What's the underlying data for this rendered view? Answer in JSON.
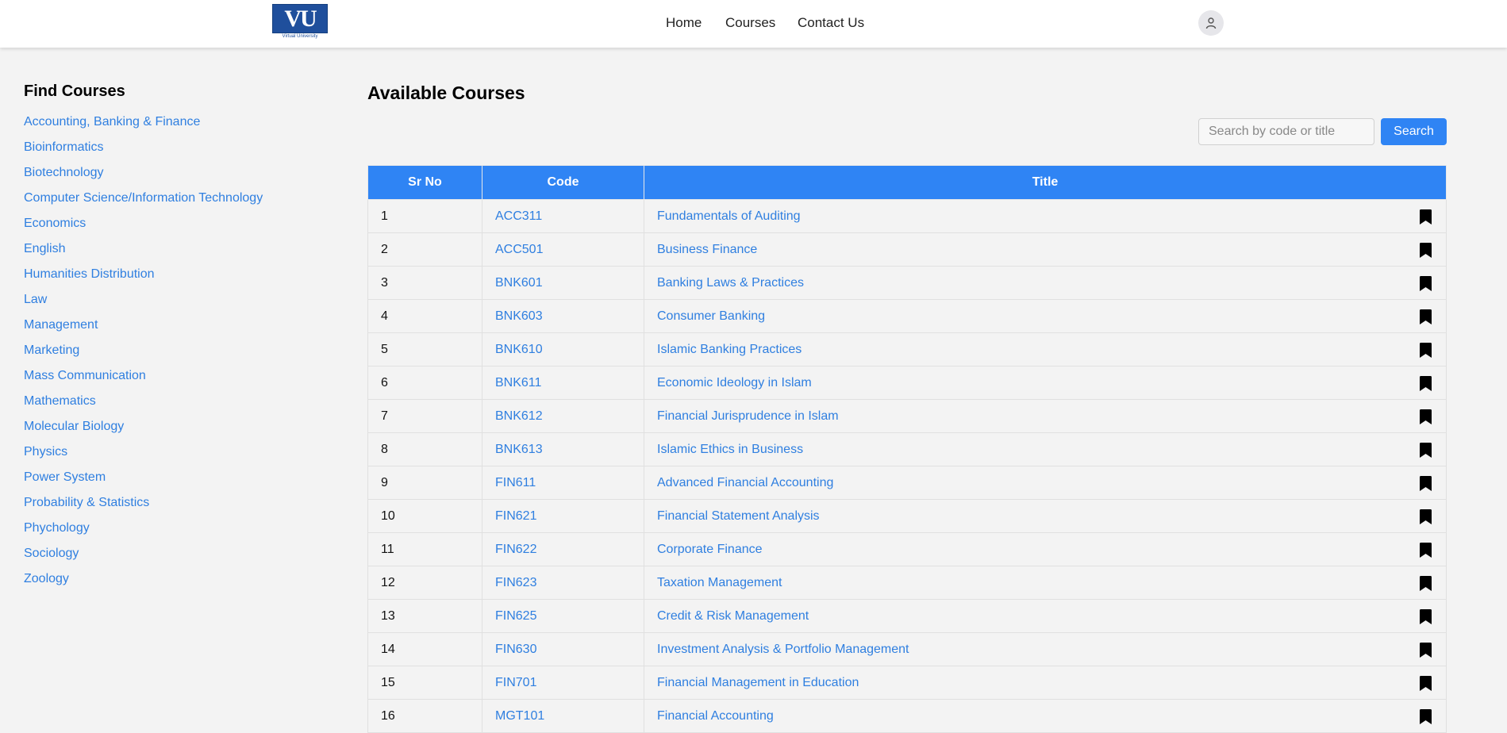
{
  "header": {
    "logo_text": "VU",
    "logo_caption": "Virtual University",
    "nav": [
      "Home",
      "Courses",
      "Contact Us"
    ]
  },
  "sidebar": {
    "heading": "Find Courses",
    "items": [
      "Accounting, Banking & Finance",
      "Bioinformatics",
      "Biotechnology",
      "Computer Science/Information Technology",
      "Economics",
      "English",
      "Humanities Distribution",
      "Law",
      "Management",
      "Marketing",
      "Mass Communication",
      "Mathematics",
      "Molecular Biology",
      "Physics",
      "Power System",
      "Probability & Statistics",
      "Phychology",
      "Sociology",
      "Zoology"
    ]
  },
  "main": {
    "title": "Available Courses",
    "search_placeholder": "Search by code or title",
    "search_button": "Search",
    "columns": [
      "Sr No",
      "Code",
      "Title"
    ],
    "rows": [
      {
        "sr": "1",
        "code": "ACC311",
        "title": "Fundamentals of Auditing"
      },
      {
        "sr": "2",
        "code": "ACC501",
        "title": "Business Finance"
      },
      {
        "sr": "3",
        "code": "BNK601",
        "title": "Banking Laws & Practices"
      },
      {
        "sr": "4",
        "code": "BNK603",
        "title": "Consumer Banking"
      },
      {
        "sr": "5",
        "code": "BNK610",
        "title": "Islamic Banking Practices"
      },
      {
        "sr": "6",
        "code": "BNK611",
        "title": "Economic Ideology in Islam"
      },
      {
        "sr": "7",
        "code": "BNK612",
        "title": "Financial Jurisprudence in Islam"
      },
      {
        "sr": "8",
        "code": "BNK613",
        "title": "Islamic Ethics in Business"
      },
      {
        "sr": "9",
        "code": "FIN611",
        "title": "Advanced Financial Accounting"
      },
      {
        "sr": "10",
        "code": "FIN621",
        "title": "Financial Statement Analysis"
      },
      {
        "sr": "11",
        "code": "FIN622",
        "title": "Corporate Finance"
      },
      {
        "sr": "12",
        "code": "FIN623",
        "title": "Taxation Management"
      },
      {
        "sr": "13",
        "code": "FIN625",
        "title": "Credit & Risk Management"
      },
      {
        "sr": "14",
        "code": "FIN630",
        "title": "Investment Analysis & Portfolio Management"
      },
      {
        "sr": "15",
        "code": "FIN701",
        "title": "Financial Management in Education"
      },
      {
        "sr": "16",
        "code": "MGT101",
        "title": "Financial Accounting"
      }
    ]
  },
  "colors": {
    "accent": "#2f84f4",
    "link": "#2f7fe0",
    "background": "#f3f3f3",
    "logo": "#1f4f9c"
  },
  "icons": {
    "avatar": "user-icon",
    "row_action": "bookmark-icon"
  }
}
